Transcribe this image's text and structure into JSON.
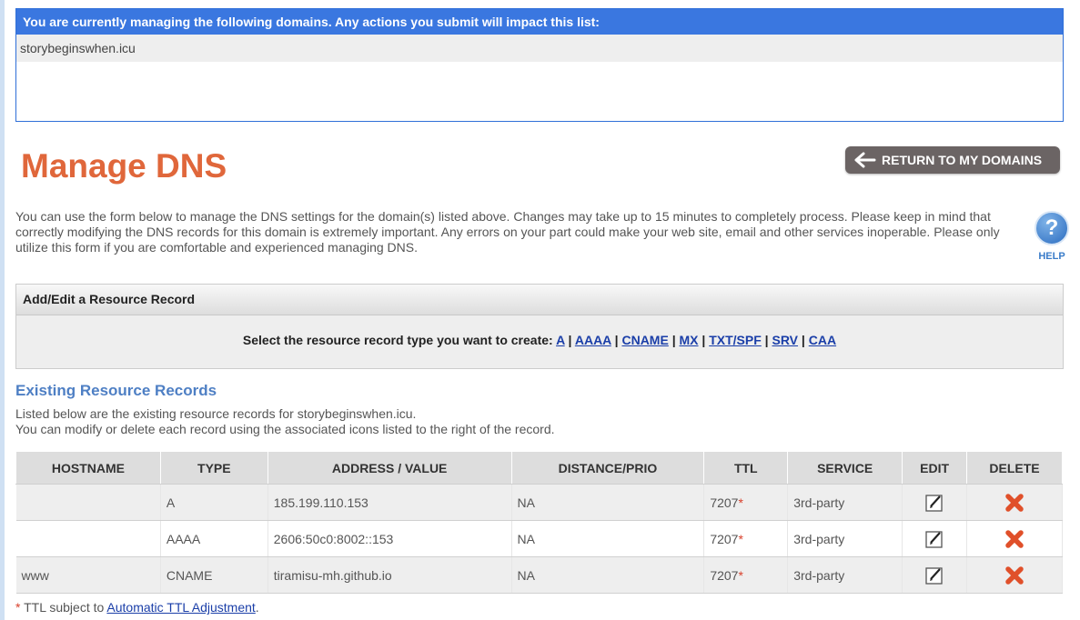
{
  "domains": {
    "header": "You are currently managing the following domains. Any actions you submit will impact this list:",
    "list": [
      "storybeginswhen.icu"
    ]
  },
  "page_title": "Manage DNS",
  "return_button": "RETURN TO MY DOMAINS",
  "intro": "You can use the form below to manage the DNS settings for the domain(s) listed above. Changes may take up to 15 minutes to completely process. Please keep in mind that correctly modifying the DNS records for this domain is extremely important. Any errors on your part could make your web site, email and other services inoperable. Please only utilize this form if you are comfortable and experienced managing DNS.",
  "help_label": "HELP",
  "help_glyph": "?",
  "resource_record": {
    "title": "Add/Edit a Resource Record",
    "prompt": "Select the resource record type you want to create:",
    "types": [
      "A",
      "AAAA",
      "CNAME",
      "MX",
      "TXT/SPF",
      "SRV",
      "CAA"
    ],
    "separator": "|"
  },
  "existing": {
    "title": "Existing Resource Records",
    "line1": "Listed below are the existing resource records for storybeginswhen.icu.",
    "line2": "You can modify or delete each record using the associated icons listed to the right of the record."
  },
  "table": {
    "headers": [
      "HOSTNAME",
      "TYPE",
      "ADDRESS / VALUE",
      "DISTANCE/PRIO",
      "TTL",
      "SERVICE",
      "EDIT",
      "DELETE"
    ],
    "rows": [
      {
        "hostname": "",
        "type": "A",
        "value": "185.199.110.153",
        "prio": "NA",
        "ttl": "7207",
        "service": "3rd-party"
      },
      {
        "hostname": "",
        "type": "AAAA",
        "value": "2606:50c0:8002::153",
        "prio": "NA",
        "ttl": "7207",
        "service": "3rd-party"
      },
      {
        "hostname": "www",
        "type": "CNAME",
        "value": "tiramisu-mh.github.io",
        "prio": "NA",
        "ttl": "7207",
        "service": "3rd-party"
      }
    ],
    "ttl_marker": "*"
  },
  "footnote": {
    "marker": "*",
    "text": " TTL subject to ",
    "link": "Automatic TTL Adjustment",
    "end": "."
  },
  "colors": {
    "accent_title": "#e0673b",
    "domains_header_bg": "#3a77e0",
    "link": "#1a3ea8",
    "delete_icon": "#e0502a"
  },
  "icons": {
    "return": "arrow-left-icon",
    "help": "help-icon",
    "edit": "edit-icon",
    "delete": "delete-icon"
  }
}
